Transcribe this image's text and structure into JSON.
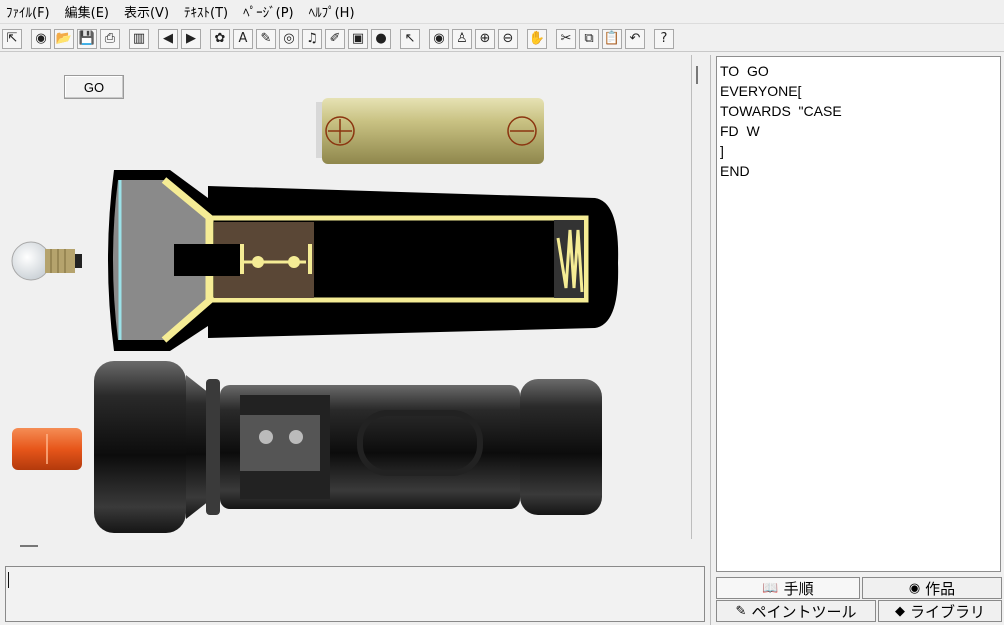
{
  "menu": [
    "ﾌｧｲﾙ(F)",
    "編集(E)",
    "表示(V)",
    "ﾃｷｽﾄ(T)",
    "ﾍﾟｰｼﾞ(P)",
    "ﾍﾙﾌﾟ(H)"
  ],
  "toolbar": {
    "icons": [
      {
        "name": "new-page-icon",
        "glyph": "⇱"
      },
      {
        "name": "globe-icon",
        "glyph": "◉"
      },
      {
        "name": "open-folder-icon",
        "glyph": "📂"
      },
      {
        "name": "save-icon",
        "glyph": "💾"
      },
      {
        "name": "print-icon",
        "glyph": "⎙"
      },
      {
        "name": "book-icon",
        "glyph": "▥"
      },
      {
        "name": "arrow-left-icon",
        "glyph": "◀"
      },
      {
        "name": "arrow-right-icon",
        "glyph": "▶"
      },
      {
        "name": "turtle-icon",
        "glyph": "✿"
      },
      {
        "name": "text-box-icon",
        "glyph": "A"
      },
      {
        "name": "paint-icon",
        "glyph": "✎"
      },
      {
        "name": "eye-icon",
        "glyph": "◎"
      },
      {
        "name": "music-icon",
        "glyph": "♫"
      },
      {
        "name": "pencil-icon",
        "glyph": "✐"
      },
      {
        "name": "camera-icon",
        "glyph": "▣"
      },
      {
        "name": "stamp-icon",
        "glyph": "●"
      },
      {
        "name": "pointer-icon",
        "glyph": "↖"
      },
      {
        "name": "view-eye-icon",
        "glyph": "◉"
      },
      {
        "name": "person-icon",
        "glyph": "♙"
      },
      {
        "name": "zoom-in-icon",
        "glyph": "⊕"
      },
      {
        "name": "zoom-out-icon",
        "glyph": "⊖"
      },
      {
        "name": "stop-hand-icon",
        "glyph": "✋"
      },
      {
        "name": "cut-icon",
        "glyph": "✂"
      },
      {
        "name": "copy-icon",
        "glyph": "⧉"
      },
      {
        "name": "paste-icon",
        "glyph": "📋"
      },
      {
        "name": "undo-icon",
        "glyph": "↶"
      },
      {
        "name": "help-icon",
        "glyph": "?"
      }
    ]
  },
  "canvas": {
    "go_label": "GO"
  },
  "code": {
    "lines": [
      "TO  GO",
      "EVERYONE[",
      "TOWARDS  \"CASE",
      "FD  W",
      "]",
      "END"
    ]
  },
  "tabs": {
    "procedures": "手順",
    "projects": "作品",
    "paint_tools": "ペイントツール",
    "library": "ライブラリ"
  },
  "colors": {
    "case_black": "#000000",
    "case_inner": "#888888",
    "brass_yellow": "#f5ec95",
    "lens_cyan": "#9be1e8",
    "switch_brown": "#5a4736",
    "battery_gold": "#b7b070",
    "cap_orange": "#e7561a"
  }
}
